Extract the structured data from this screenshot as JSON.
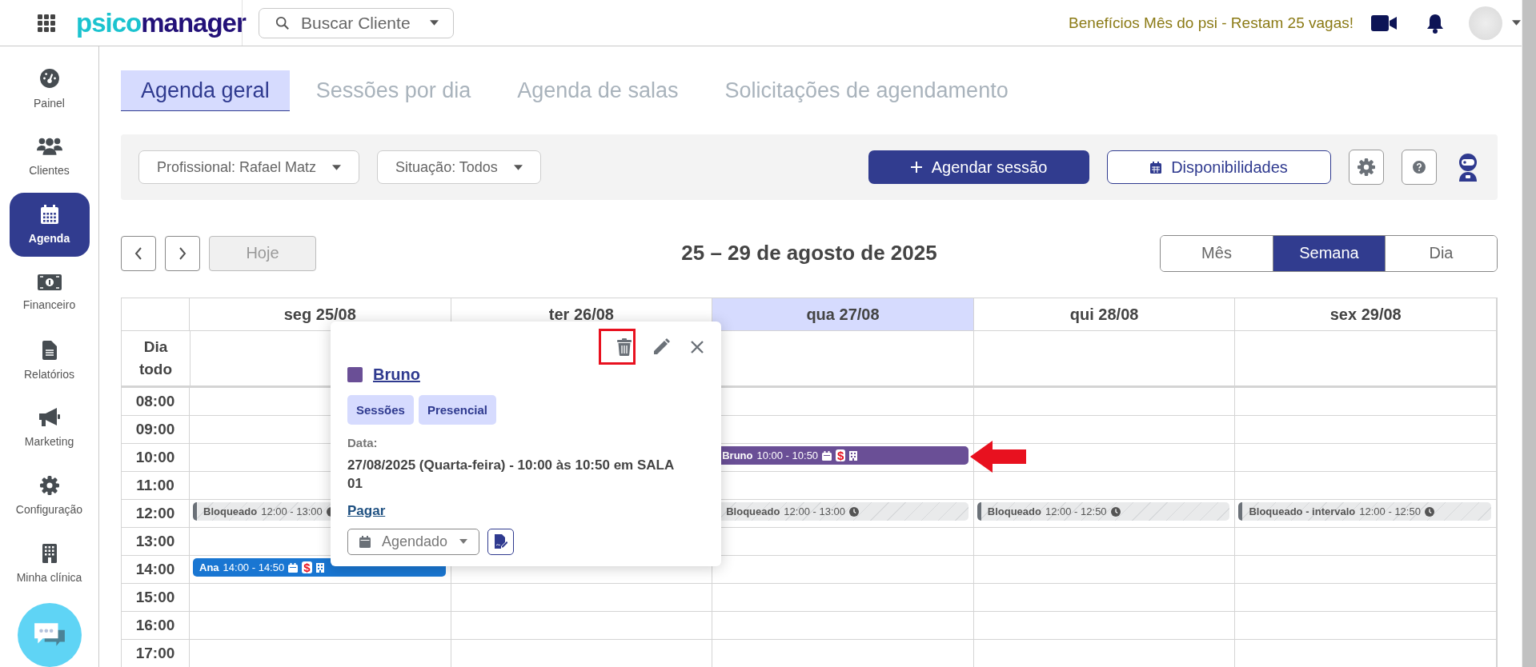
{
  "topbar": {
    "logo": [
      "psico",
      "manager"
    ],
    "search": {
      "placeholder": "Buscar Cliente"
    },
    "promo": "Benefícios Mês do psi - Restam 25 vagas!"
  },
  "sidebar": {
    "items": [
      {
        "label": "Painel",
        "selected": false
      },
      {
        "label": "Clientes",
        "selected": false
      },
      {
        "label": "Agenda",
        "selected": true
      },
      {
        "label": "Financeiro",
        "selected": false
      },
      {
        "label": "Relatórios",
        "selected": false
      },
      {
        "label": "Marketing",
        "selected": false
      },
      {
        "label": "Configuração",
        "selected": false
      },
      {
        "label": "Minha clínica",
        "selected": false
      }
    ]
  },
  "tabs": [
    {
      "label": "Agenda geral",
      "selected": true
    },
    {
      "label": "Sessões por dia",
      "selected": false
    },
    {
      "label": "Agenda de salas",
      "selected": false
    },
    {
      "label": "Solicitações de agendamento",
      "selected": false
    }
  ],
  "filters": [
    "Profissional: Rafael Matz",
    "Situação: Todos"
  ],
  "actions": {
    "primary": "Agendar sessão",
    "secondary": "Disponibilidades"
  },
  "nav": {
    "today": {
      "label": "Hoje",
      "disabled": true
    },
    "title": "25 – 29 de agosto de 2025",
    "views": [
      {
        "label": "Mês",
        "selected": false
      },
      {
        "label": "Semana",
        "selected": true
      },
      {
        "label": "Dia",
        "selected": false
      }
    ]
  },
  "calendar": {
    "all_day": "Dia todo",
    "days": [
      {
        "label": "seg 25/08",
        "selected": false
      },
      {
        "label": "ter 26/08",
        "selected": false
      },
      {
        "label": "qua 27/08",
        "selected": true
      },
      {
        "label": "qui 28/08",
        "selected": false
      },
      {
        "label": "sex 29/08",
        "selected": false
      }
    ],
    "rows": [
      {
        "time": "08:00"
      },
      {
        "time": "09:00"
      },
      {
        "time": "10:00",
        "cells": [
          null,
          null,
          {
            "kind": "session",
            "name": "Bruno",
            "time": "10:00 - 10:50",
            "payment": "$",
            "color": "#6a4f96"
          },
          null,
          null
        ]
      },
      {
        "time": "11:00"
      },
      {
        "time": "12:00",
        "cells": [
          {
            "kind": "blocked",
            "name": "Bloqueado",
            "time": "12:00 - 13:00"
          },
          null,
          {
            "kind": "blocked",
            "name": "Bloqueado",
            "time": "12:00 - 13:00"
          },
          {
            "kind": "blocked",
            "name": "Bloqueado",
            "time": "12:00 - 12:50"
          },
          {
            "kind": "blocked",
            "name": "Bloqueado - intervalo",
            "time": "12:00 - 12:50"
          }
        ]
      },
      {
        "time": "13:00"
      },
      {
        "time": "14:00",
        "cells": [
          {
            "kind": "session",
            "name": "Ana",
            "time": "14:00 - 14:50",
            "payment": "$",
            "color": "#1976d2"
          },
          null,
          null,
          null,
          null
        ]
      },
      {
        "time": "15:00"
      },
      {
        "time": "16:00"
      },
      {
        "time": "17:00"
      }
    ]
  },
  "popup": {
    "color": "#6a4f96",
    "name": "Bruno",
    "tags": [
      "Sessões",
      "Presencial"
    ],
    "date_label": "Data:",
    "date": "27/08/2025 (Quarta-feira) - 10:00 às 10:50 em SALA 01",
    "pay_link": "Pagar",
    "status": "Agendado"
  }
}
